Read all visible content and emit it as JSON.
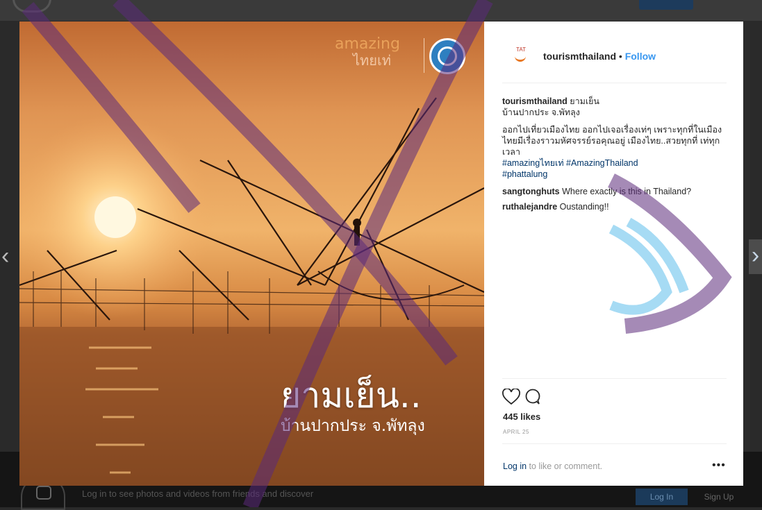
{
  "background": {
    "login_prompt": "Log in to see photos and videos from friends and discover",
    "login_button": "Log In",
    "signup_button": "Sign Up"
  },
  "nav": {
    "prev_icon": "chevron-left-icon",
    "next_icon": "chevron-right-icon",
    "prev_glyph": "‹",
    "next_glyph": "›"
  },
  "post": {
    "image": {
      "brand_top": "amazing",
      "brand_bottom": "ไทยเท่",
      "caption_title": "ยามเย็น..",
      "caption_subtitle": "บ้านปากประ จ.พัทลุง"
    },
    "header": {
      "avatar_text": "TAT",
      "username": "tourismthailand",
      "separator": "•",
      "follow_label": "Follow"
    },
    "caption": {
      "username": "tourismthailand",
      "line1": "ยามเย็น",
      "line2": "บ้านปากประ จ.พัทลุง",
      "body": "ออกไปเที่ยวเมืองไทย ออกไปเจอเรื่องเท่ๆ เพราะทุกที่ในเมืองไทยมีเรื่องราวมหัศจรรย์รอคุณอยู่ เมืองไทย..สวยทุกที่ เท่ทุกเวลา",
      "tag1": "#amazingไทยเท่",
      "tag2": "#AmazingThailand",
      "tag3": "#phattalung"
    },
    "comments": [
      {
        "user": "sangtonghuts",
        "text": "Where exactly is this in Thailand?"
      },
      {
        "user": "ruthalejandre",
        "text": "Oustanding!!"
      }
    ],
    "likes": "445 likes",
    "date": "APRIL 25",
    "login_link": "Log in",
    "login_rest": "to like or comment.",
    "more": "•••"
  },
  "colors": {
    "link": "#3897f0",
    "tag": "#003569",
    "text": "#262626",
    "muted": "#999999"
  }
}
